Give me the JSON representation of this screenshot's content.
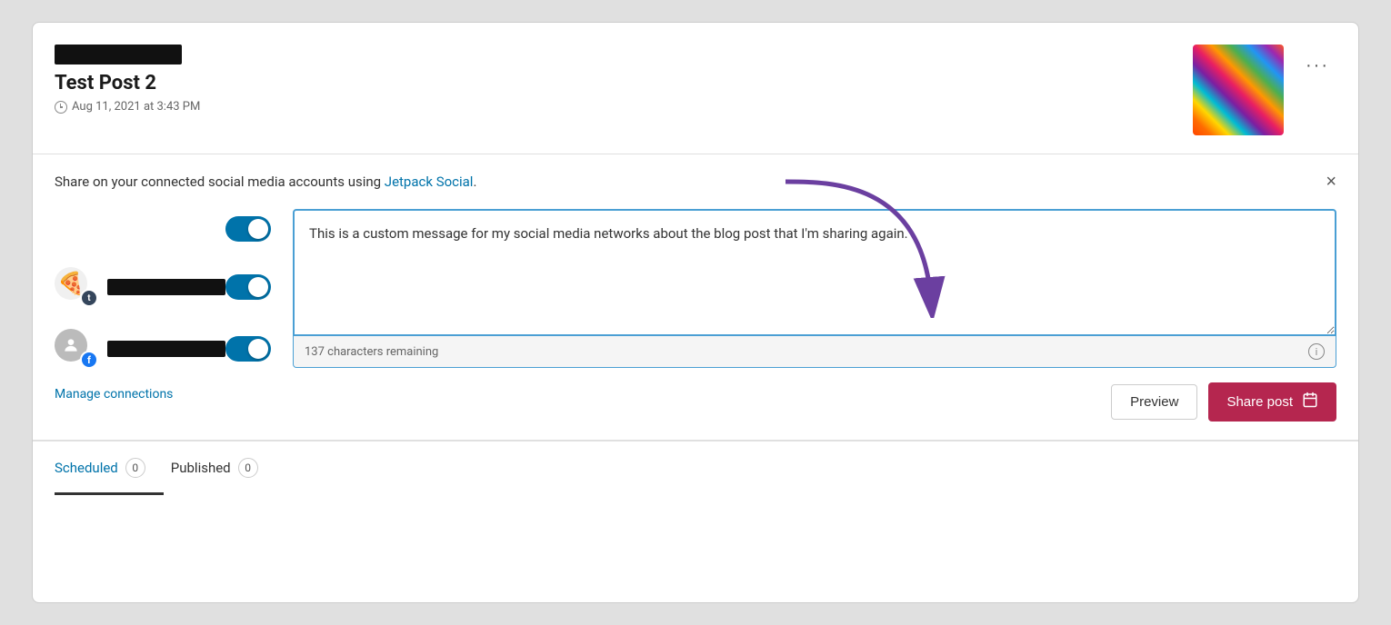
{
  "card": {
    "header": {
      "title": "Test Post 2",
      "date": "Aug 11, 2021 at 3:43 PM",
      "more_label": "···"
    },
    "share_section": {
      "description_prefix": "Share on your connected social media accounts using ",
      "jetpack_link_text": "Jetpack Social",
      "description_suffix": ".",
      "close_label": "×",
      "message_text": "This is a custom message for my social media networks about the blog post that I'm sharing again.",
      "char_remaining": "137 characters remaining",
      "connections": [
        {
          "id": "tumblr",
          "badge_type": "tumblr",
          "badge_label": "t",
          "enabled": true
        },
        {
          "id": "facebook",
          "badge_type": "facebook",
          "badge_label": "f",
          "enabled": true
        }
      ],
      "manage_connections_label": "Manage connections",
      "preview_label": "Preview",
      "share_label": "Share post"
    },
    "footer": {
      "tabs": [
        {
          "label": "Scheduled",
          "count": "0",
          "active": true
        },
        {
          "label": "Published",
          "count": "0",
          "active": false
        }
      ]
    }
  }
}
